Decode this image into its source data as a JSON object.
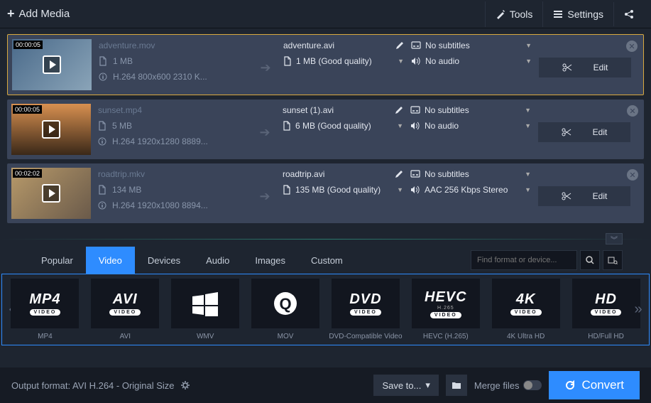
{
  "topbar": {
    "add_media": "Add Media",
    "tools": "Tools",
    "settings": "Settings"
  },
  "files": [
    {
      "selected": true,
      "duration": "00:00:05",
      "name": "adventure.mov",
      "size": "1 MB",
      "codec": "H.264 800x600 2310 K...",
      "out_name": "adventure.avi",
      "out_size": "1 MB (Good quality)",
      "subtitles": "No subtitles",
      "audio": "No audio",
      "edit": "Edit",
      "thumb_bg": "linear-gradient(135deg,#4a6a8a,#8aa4b8)"
    },
    {
      "selected": false,
      "duration": "00:00:05",
      "name": "sunset.mp4",
      "size": "5 MB",
      "codec": "H.264 1920x1280 8889...",
      "out_name": "sunset (1).avi",
      "out_size": "6 MB (Good quality)",
      "subtitles": "No subtitles",
      "audio": "No audio",
      "edit": "Edit",
      "thumb_bg": "linear-gradient(180deg,#d89050,#3a2818)"
    },
    {
      "selected": false,
      "duration": "00:02:02",
      "name": "roadtrip.mkv",
      "size": "134 MB",
      "codec": "H.264 1920x1080 8894...",
      "out_name": "roadtrip.avi",
      "out_size": "135 MB (Good quality)",
      "subtitles": "No subtitles",
      "audio": "AAC 256 Kbps Stereo",
      "edit": "Edit",
      "thumb_bg": "linear-gradient(135deg,#b89a6a,#6a5a4a)"
    }
  ],
  "format_tabs": [
    "Popular",
    "Video",
    "Devices",
    "Audio",
    "Images",
    "Custom"
  ],
  "active_tab_index": 1,
  "search_placeholder": "Find format or device...",
  "formats": [
    {
      "big": "MP4",
      "sub": "VIDEO",
      "label": "MP4"
    },
    {
      "big": "AVI",
      "sub": "VIDEO",
      "label": "AVI"
    },
    {
      "big": "",
      "sub": "",
      "label": "WMV",
      "win": true
    },
    {
      "big": "Q",
      "sub": "",
      "label": "MOV",
      "circle": true
    },
    {
      "big": "DVD",
      "sub": "VIDEO",
      "label": "DVD-Compatible Video"
    },
    {
      "big": "HEVC",
      "sub": "VIDEO",
      "label": "HEVC (H.265)",
      "extra": "H.265"
    },
    {
      "big": "4K",
      "sub": "VIDEO",
      "label": "4K Ultra HD"
    },
    {
      "big": "HD",
      "sub": "VIDEO",
      "label": "HD/Full HD"
    }
  ],
  "bottom": {
    "output_format": "Output format: AVI H.264 - Original Size",
    "save_to": "Save to...",
    "merge": "Merge files",
    "convert": "Convert"
  }
}
